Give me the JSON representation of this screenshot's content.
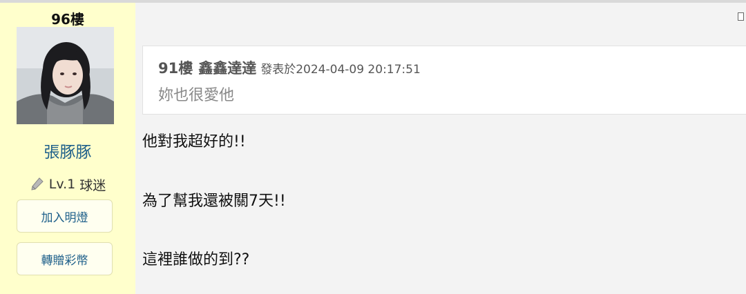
{
  "sidebar": {
    "floor": "96樓",
    "username": "張豚豚",
    "level": "Lv.1",
    "rank": "球迷",
    "level_icon": "pencil-icon",
    "buttons": {
      "light": "加入明燈",
      "gift": "轉贈彩幣"
    }
  },
  "quote": {
    "floor": "91樓",
    "user": "鑫鑫達達",
    "posted": "發表於2024-04-09 20:17:51",
    "text": "妳也很愛他"
  },
  "post": {
    "lines": [
      "他對我超好的!!",
      "為了幫我還被關7天!!",
      "這裡誰做的到??"
    ]
  },
  "colors": {
    "sidebar_bg": "#ffffcc",
    "link": "#1d5f8a",
    "page_bg": "#f3f3f3"
  }
}
